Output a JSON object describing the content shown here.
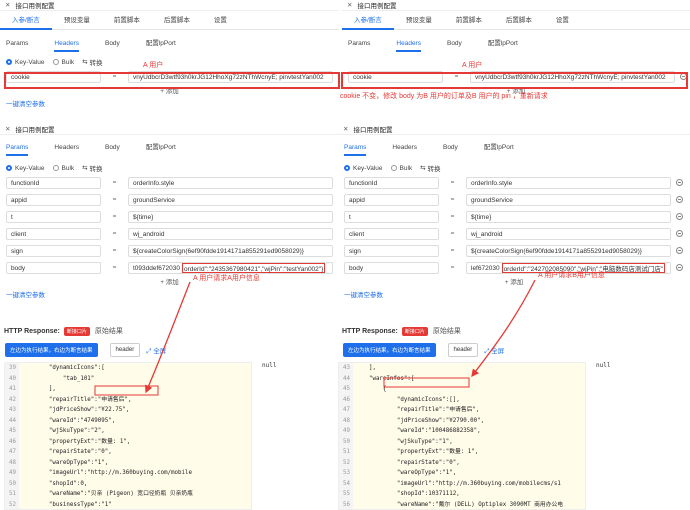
{
  "dialog_title": "接口用例配置",
  "top_tabs": [
    "入参/断言",
    "预设变量",
    "前置脚本",
    "后置脚本",
    "设置"
  ],
  "sub_tabs": [
    "Params",
    "Headers",
    "Body",
    "配置lpPort"
  ],
  "kv_label": "Key-Value",
  "bulk_label": "Bulk",
  "switch_label": "转换",
  "add_label": "+ 添加",
  "clear_label": "一键清空参数",
  "top_left": {
    "key": "cookie",
    "value": "vnyUdbcrD3wtf93h0krJG12HhoXg72zNThWcnyE; pinvtestYan002"
  },
  "top_right": {
    "key": "cookie",
    "value": "vnyUdbcrD3wtf93h0krJG12HhoXg72zNThWcnyE; pinvtestYan002"
  },
  "ann_user_a": "A 用户",
  "ann_cookie_note": "cookie 不变，修改 body 为B 用户的订单及B 用户的 pin ，重新请求",
  "ann_req_a": "A 用户请求A用户信息",
  "ann_req_b": "A 用户请求B用户信息",
  "params_left": [
    {
      "key": "functionId",
      "value": "orderInfo.style"
    },
    {
      "key": "appid",
      "value": "groundService"
    },
    {
      "key": "t",
      "value": "${time}"
    },
    {
      "key": "client",
      "value": "wj_android"
    },
    {
      "key": "sign",
      "value": "${createColorSign(6ef90fdde1914171a855291ed9058029)}"
    },
    {
      "key": "body",
      "value": "t093ddef672030",
      "extra": "orderId\":\"2435367980421\",\"wjPin\":\"testYan002\"}"
    }
  ],
  "params_right": [
    {
      "key": "functionId",
      "value": "orderInfo.style"
    },
    {
      "key": "appid",
      "value": "groundService"
    },
    {
      "key": "t",
      "value": "${time}"
    },
    {
      "key": "client",
      "value": "wj_android"
    },
    {
      "key": "sign",
      "value": "${createColorSign(6ef90fdde1914171a855291ed9058029)}"
    },
    {
      "key": "body",
      "value": "lef672030",
      "extra": "orderId\":\"242702085090\",\"wjPin\":\"电脑数码店测试门店\""
    }
  ],
  "http_response_label": "HTTP Response:",
  "badge_label": "断接口片",
  "raw_label": "原始结果",
  "exec_btn": "左边为执行结果，右边为断言结果",
  "header_btn": "header",
  "share_label": "全屏",
  "null_text": "null",
  "code_left": [
    {
      "n": "39",
      "t": "        \"dynamicIcons\":["
    },
    {
      "n": "40",
      "t": "            \"tab_101\""
    },
    {
      "n": "41",
      "t": "        ],"
    },
    {
      "n": "42",
      "t": "        \"repairTitle\":\"申请售后\","
    },
    {
      "n": "43",
      "t": "        \"jdPriceShow\":\"¥22.75\","
    },
    {
      "n": "44",
      "t": "        \"wareId\":\"4749095\","
    },
    {
      "n": "45",
      "t": "        \"wjSkuType\":\"2\","
    },
    {
      "n": "46",
      "t": "        \"propertyExt\":\"数量: 1\","
    },
    {
      "n": "47",
      "t": "        \"repairState\":\"0\","
    },
    {
      "n": "48",
      "t": "        \"wareOpType\":\"1\","
    },
    {
      "n": "49",
      "t": "        \"imageUrl\":\"http://m.360buying.com/mobile"
    },
    {
      "n": "50",
      "t": "        \"shopId\":0,"
    },
    {
      "n": "51",
      "t": "        \"wareName\":\"贝亲 (Pigeon) 宽口径奶瓶 贝亲奶瓶"
    },
    {
      "n": "52",
      "t": "        \"businessType\":\"1\""
    },
    {
      "n": "53",
      "t": "    }"
    }
  ],
  "code_right": [
    {
      "n": "43",
      "t": "    ],"
    },
    {
      "n": "44",
      "t": "    \"wareInfos\":["
    },
    {
      "n": "45",
      "t": "        {"
    },
    {
      "n": "46",
      "t": "            \"dynamicIcons\":[],"
    },
    {
      "n": "47",
      "t": "            \"repairTitle\":\"申请售后\","
    },
    {
      "n": "48",
      "t": "            \"jdPriceShow\":\"¥2790.00\","
    },
    {
      "n": "49",
      "t": "            \"wareId\":\"100486882358\","
    },
    {
      "n": "50",
      "t": "            \"wjSkuType\":\"1\","
    },
    {
      "n": "51",
      "t": "            \"propertyExt\":\"数量: 1\","
    },
    {
      "n": "52",
      "t": "            \"repairState\":\"0\","
    },
    {
      "n": "53",
      "t": "            \"wareOpType\":\"1\","
    },
    {
      "n": "54",
      "t": "            \"imageUrl\":\"http://m.360buying.com/mobilecms/s1"
    },
    {
      "n": "55",
      "t": "            \"shopId\":10371112,"
    },
    {
      "n": "56",
      "t": "            \"wareName\":\"戴尔 (DELL) Optiplex 3090MT 商用办公电"
    },
    {
      "n": "57",
      "t": "            \"businessType\":\"1\""
    },
    {
      "n": "58",
      "t": "        }"
    }
  ]
}
